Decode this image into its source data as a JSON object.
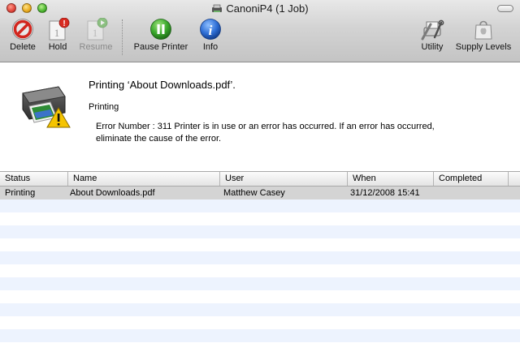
{
  "window": {
    "title": "CanoniP4 (1 Job)"
  },
  "toolbar": {
    "delete_label": "Delete",
    "hold_label": "Hold",
    "resume_label": "Resume",
    "pause_label": "Pause Printer",
    "info_label": "Info",
    "utility_label": "Utility",
    "supply_label": "Supply Levels"
  },
  "status": {
    "job_title": "Printing ‘About Downloads.pdf’.",
    "job_state": "Printing",
    "error_message": "Error Number : 311 Printer is in use or an error has occurred. If an error has occurred, eliminate the cause of the error."
  },
  "table": {
    "columns": [
      "Status",
      "Name",
      "User",
      "When",
      "Completed"
    ],
    "rows": [
      {
        "status": "Printing",
        "name": "About Downloads.pdf",
        "user": "Matthew Casey",
        "when": "31/12/2008 15:41",
        "completed": ""
      }
    ]
  },
  "colors": {
    "selected_row": "#d4d4d4",
    "stripe_row": "#edf3fe",
    "pause_button": "#3aa82c",
    "info_button": "#2f6fd6",
    "delete_button": "#d2261e",
    "warning": "#f5c400"
  }
}
